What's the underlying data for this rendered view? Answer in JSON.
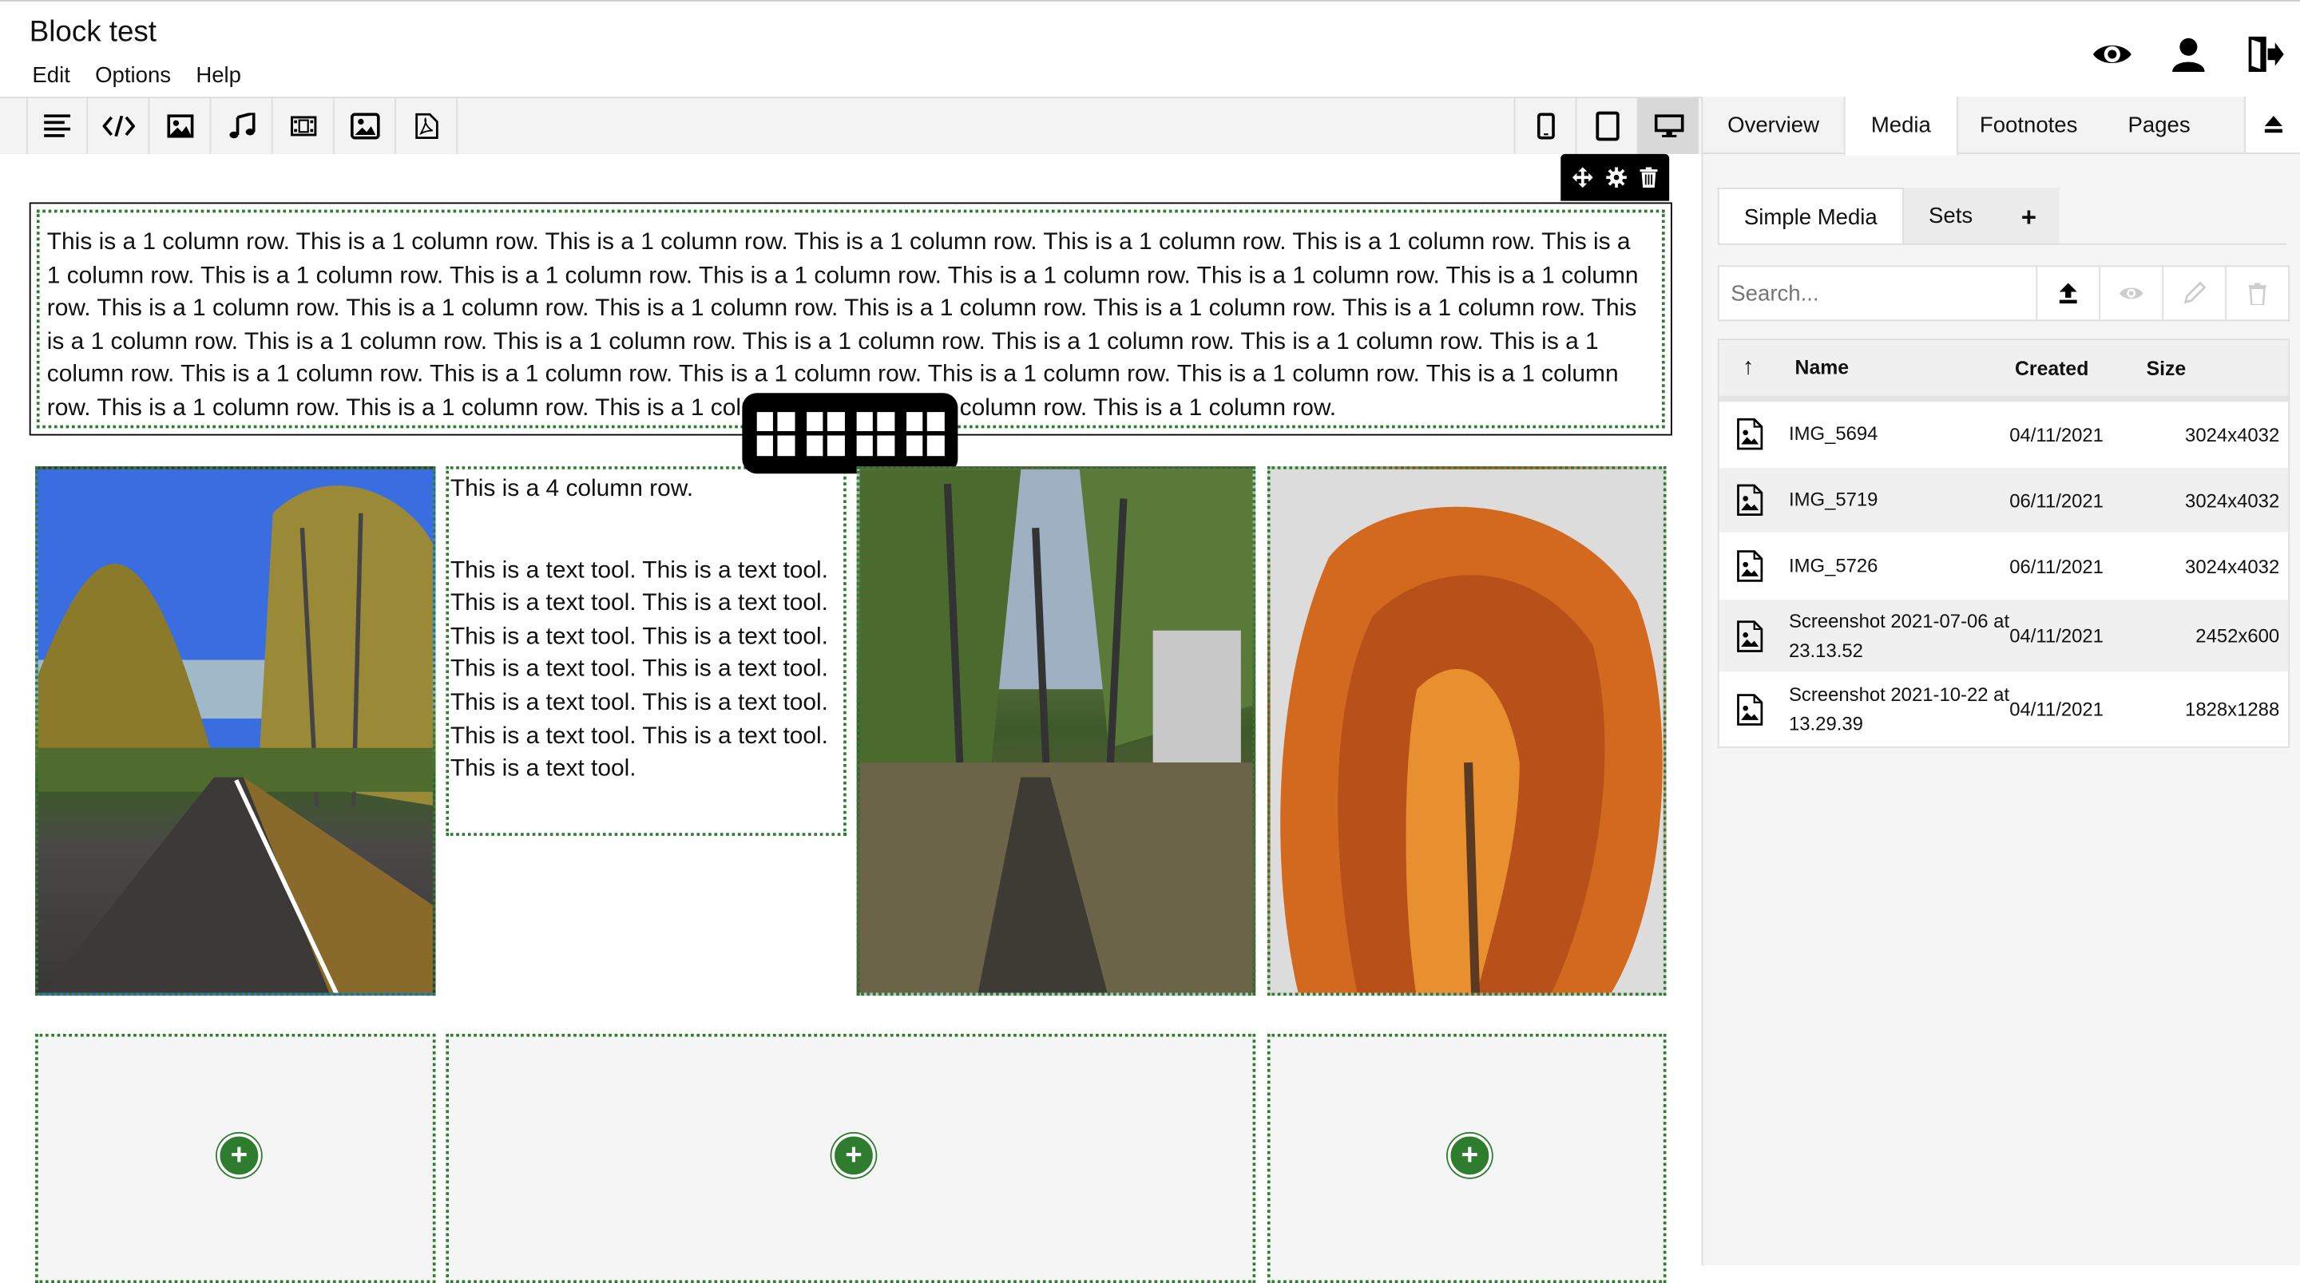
{
  "app": {
    "title": "Block test"
  },
  "menu": [
    "Edit",
    "Options",
    "Help"
  ],
  "top_icons": [
    "eye-icon",
    "user-icon",
    "logout-icon"
  ],
  "toolbar": {
    "tools": [
      "text-align-icon",
      "code-icon",
      "image-icon",
      "music-icon",
      "video-icon",
      "gallery-icon",
      "pdf-icon"
    ],
    "devices": [
      "phone-icon",
      "tablet-icon",
      "desktop-icon"
    ],
    "active_device": "desktop"
  },
  "editor": {
    "row1_text": "This is a 1 column row. This is a 1 column row. This is a 1 column row. This is a 1 column row. This is a 1 column row. This is a 1 column row. This is a 1 column row. This is a 1 column row. This is a 1 column row. This is a 1 column row. This is a 1 column row. This is a 1 column row. This is a 1 column row. This is a 1 column row. This is a 1 column row. This is a 1 column row. This is a 1 column row. This is a 1 column row. This is a 1 column row. This is a 1 column row. This is a 1 column row. This is a 1 column row. This is a 1 column row. This is a 1 column row. This is a 1 column row. This is a 1 column row. This is a 1 column row. This is a 1 column row. This is a 1 column row. This is a 1 column row. This is a 1 column row. This is a 1 column row. This is a 1 column row. This is a 1 column row. This is a 1 column row. This is a 1 column row. This is a 1 column row.",
    "row2_heading": "This is a 4 column row.",
    "row2_text": "This is a text tool. This is a text tool. This is a text tool. This is a text tool. This is a text tool. This is a text tool. This is a text tool. This is a text tool. This is a text tool. This is a text tool. This is a text tool. This is a text tool. This is a text tool."
  },
  "panel": {
    "tabs": [
      "Overview",
      "Media",
      "Footnotes",
      "Pages"
    ],
    "active_tab": "Media",
    "subtabs": [
      "Simple Media",
      "Sets",
      "+"
    ],
    "search_placeholder": "Search...",
    "columns": {
      "sort": "↑",
      "name": "Name",
      "created": "Created",
      "size": "Size"
    },
    "media": [
      {
        "name": "IMG_5694",
        "created": "04/11/2021",
        "size": "3024x4032"
      },
      {
        "name": "IMG_5719",
        "created": "06/11/2021",
        "size": "3024x4032"
      },
      {
        "name": "IMG_5726",
        "created": "06/11/2021",
        "size": "3024x4032"
      },
      {
        "name": "Screenshot 2021-07-06 at 23.13.52",
        "created": "04/11/2021",
        "size": "2452x600"
      },
      {
        "name": "Screenshot 2021-10-22 at 13.29.39",
        "created": "04/11/2021",
        "size": "1828x1288"
      }
    ]
  }
}
